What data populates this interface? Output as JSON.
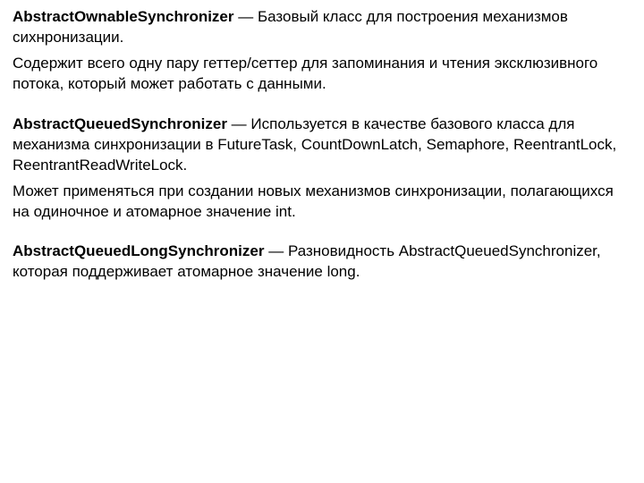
{
  "entries": [
    {
      "title": "AbstractOwnableSynchronizer",
      "sep": " — ",
      "desc": "Базовый класс для построения механизмов сихнронизации.",
      "detail": "Содержит всего одну пару геттер/сеттер для запоминания и чтения эксклюзивного потока, который может работать с данными."
    },
    {
      "title": "AbstractQueuedSynchronizer",
      "sep": " — ",
      "desc": "Используется в качестве базового класса для механизма синхронизации в FutureTask, CountDownLatch, Semaphore, ReentrantLock, ReentrantReadWriteLock.",
      "detail": "Может применяться при создании новых механизмов синхронизации, полагающихся на одиночное и атомарное значение int."
    },
    {
      "title": "AbstractQueuedLongSynchronizer",
      "sep": " — ",
      "desc": "Разновидность AbstractQueuedSynchronizer, которая поддерживает атомарное значение long.",
      "detail": ""
    }
  ]
}
